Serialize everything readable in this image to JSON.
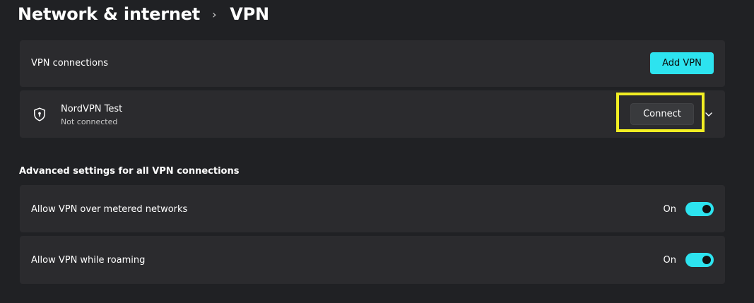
{
  "header": {
    "parent": "Network & internet",
    "separator": "›",
    "current": "VPN"
  },
  "vpn_connections": {
    "label": "VPN connections",
    "add_button": "Add VPN"
  },
  "connection": {
    "name": "NordVPN Test",
    "status": "Not connected",
    "connect_button": "Connect",
    "icon": "shield-icon",
    "expand_icon": "chevron-down-icon"
  },
  "advanced": {
    "heading": "Advanced settings for all VPN connections",
    "settings": [
      {
        "label": "Allow VPN over metered networks",
        "state": "On",
        "enabled": true
      },
      {
        "label": "Allow VPN while roaming",
        "state": "On",
        "enabled": true
      }
    ]
  },
  "colors": {
    "background": "#202124",
    "card": "#2b2b2e",
    "accent": "#2de3ef",
    "highlight": "#f2ee23"
  }
}
